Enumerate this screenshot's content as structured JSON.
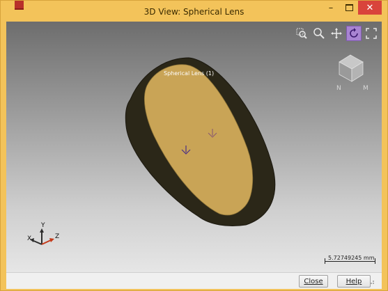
{
  "window": {
    "title": "3D View: Spherical Lens",
    "minimize_icon": "minimize-icon",
    "maximize_icon": "maximize-icon",
    "close_icon": "close-icon",
    "accent_color": "#f3c35a",
    "close_color": "#d9443b"
  },
  "toolbar": {
    "tools": [
      {
        "name": "zoom-window-icon",
        "active": false
      },
      {
        "name": "zoom-icon",
        "active": false
      },
      {
        "name": "pan-icon",
        "active": false
      },
      {
        "name": "rotate-icon",
        "active": true
      },
      {
        "name": "fit-view-icon",
        "active": false
      }
    ]
  },
  "viewport": {
    "object_label": "Spherical Lens (1)",
    "axes": {
      "x": "X",
      "y": "Y",
      "z": "Z"
    },
    "view_cube_labels": {
      "left": "N",
      "right": "M"
    },
    "scale_bar_text": "5.72749245 mm",
    "lens_face_color": "#c9a456",
    "lens_rim_color": "#2b2718"
  },
  "footer": {
    "close_label": "Close",
    "help_label": "Help"
  }
}
